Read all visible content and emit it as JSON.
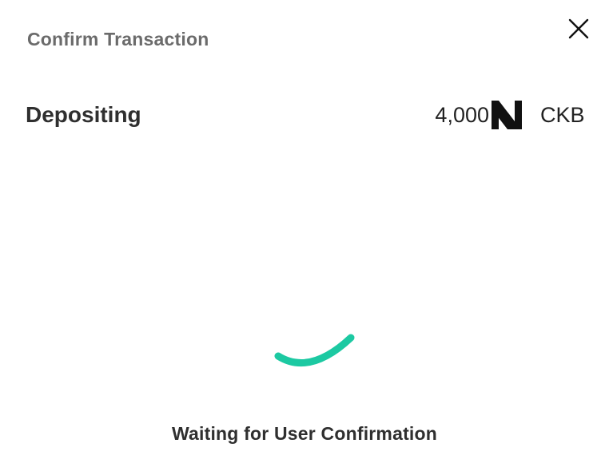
{
  "dialog": {
    "title": "Confirm Transaction",
    "close_icon": "close-icon"
  },
  "deposit": {
    "label": "Depositing",
    "amount": "4,000",
    "token_icon": "nervos-logo-icon",
    "token_symbol": "CKB"
  },
  "spinner": {
    "icon": "loading-spinner-icon",
    "color": "#1cc9a2"
  },
  "status": {
    "message": "Waiting for User Confirmation"
  }
}
